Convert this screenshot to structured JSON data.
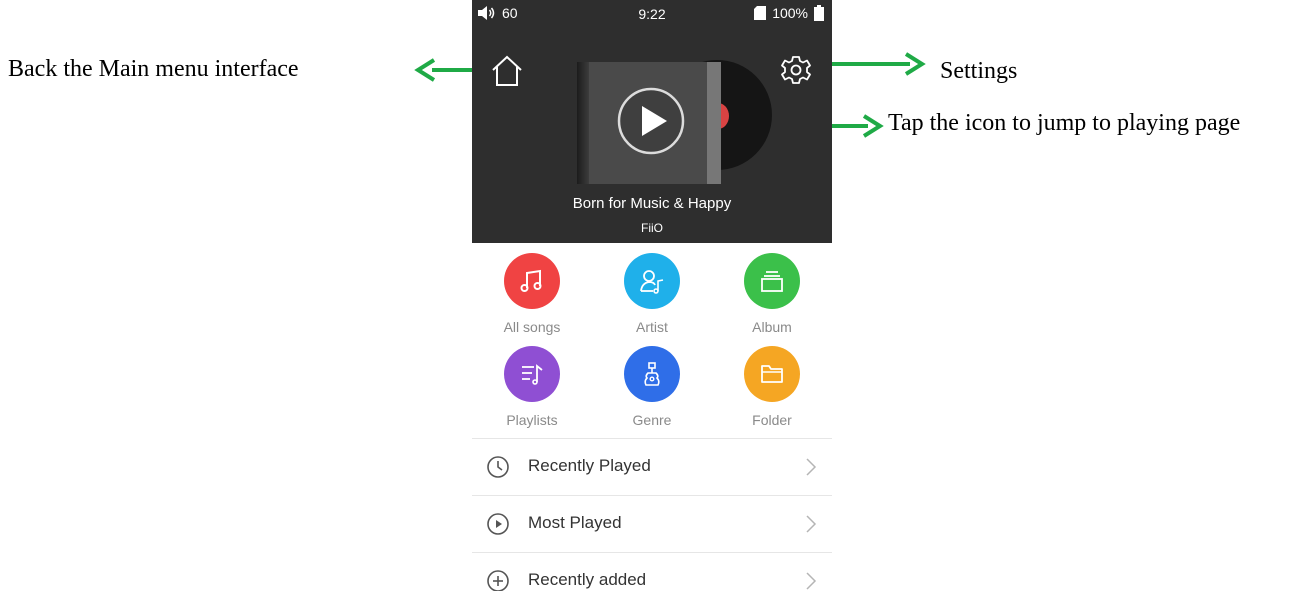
{
  "annotations": {
    "home": "Back the Main menu interface",
    "settings": "Settings",
    "play": "Tap the icon to jump to playing page"
  },
  "status_bar": {
    "volume": "60",
    "time": "9:22",
    "battery": "100%"
  },
  "now_playing": {
    "title": "Born for Music & Happy",
    "artist": "FiiO"
  },
  "categories": [
    {
      "label": "All songs",
      "icon": "music-note-icon",
      "color": "#f04343"
    },
    {
      "label": "Artist",
      "icon": "artist-icon",
      "color": "#1fb0ea"
    },
    {
      "label": "Album",
      "icon": "album-stack-icon",
      "color": "#3bc04a"
    },
    {
      "label": "Playlists",
      "icon": "playlist-icon",
      "color": "#8f4fd3"
    },
    {
      "label": "Genre",
      "icon": "guitar-icon",
      "color": "#2f6ee8"
    },
    {
      "label": "Folder",
      "icon": "folder-icon",
      "color": "#f5a623"
    }
  ],
  "list_items": [
    {
      "label": "Recently Played",
      "icon": "clock-icon"
    },
    {
      "label": "Most Played",
      "icon": "play-circle-icon"
    },
    {
      "label": "Recently added",
      "icon": "plus-circle-icon"
    }
  ],
  "colors": {
    "top_panel": "#2e2e2e",
    "annotation_arrow": "#1faa46",
    "category_label": "#8a8a8a"
  }
}
